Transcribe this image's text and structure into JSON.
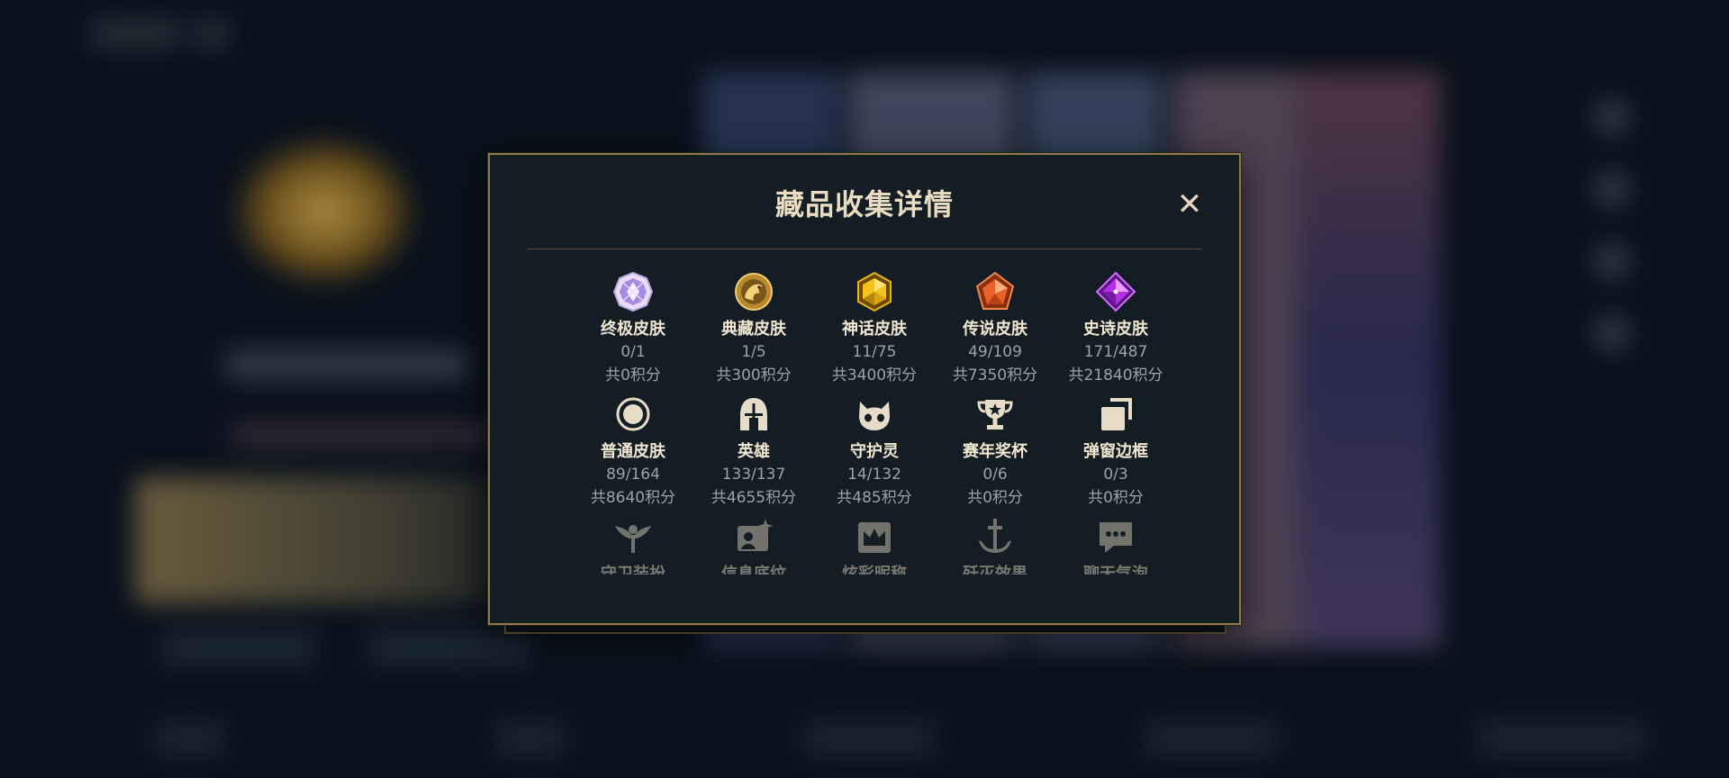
{
  "dialog": {
    "title": "藏品收集详情",
    "close_label": "✕"
  },
  "categories": [
    {
      "label": "终极皮肤",
      "count": "0/1",
      "points": "共0积分",
      "icon": "ultimate-gem-icon"
    },
    {
      "label": "典藏皮肤",
      "count": "1/5",
      "points": "共300积分",
      "icon": "dragon-emblem-icon"
    },
    {
      "label": "神话皮肤",
      "count": "11/75",
      "points": "共3400积分",
      "icon": "mythic-gem-icon"
    },
    {
      "label": "传说皮肤",
      "count": "49/109",
      "points": "共7350积分",
      "icon": "legendary-gem-icon"
    },
    {
      "label": "史诗皮肤",
      "count": "171/487",
      "points": "共21840积分",
      "icon": "epic-gem-icon"
    },
    {
      "label": "普通皮肤",
      "count": "89/164",
      "points": "共8640积分",
      "icon": "ring-icon"
    },
    {
      "label": "英雄",
      "count": "133/137",
      "points": "共4655积分",
      "icon": "helmet-icon"
    },
    {
      "label": "守护灵",
      "count": "14/132",
      "points": "共485积分",
      "icon": "cat-head-icon"
    },
    {
      "label": "赛年奖杯",
      "count": "0/6",
      "points": "共0积分",
      "icon": "trophy-icon"
    },
    {
      "label": "弹窗边框",
      "count": "0/3",
      "points": "共0积分",
      "icon": "stacked-frames-icon"
    },
    {
      "label": "守卫装扮",
      "icon": "ward-icon"
    },
    {
      "label": "信息底纹",
      "icon": "sparkle-card-icon"
    },
    {
      "label": "炫彩昵称",
      "icon": "crown-card-icon"
    },
    {
      "label": "歼灭效果",
      "icon": "anchor-sword-icon"
    },
    {
      "label": "聊天气泡",
      "icon": "chat-bubble-icon"
    }
  ],
  "colors": {
    "panel": "#141c24",
    "border_gold": "#8f7a4d",
    "title": "#e9dcc0",
    "muted": "#9aa3ac"
  }
}
